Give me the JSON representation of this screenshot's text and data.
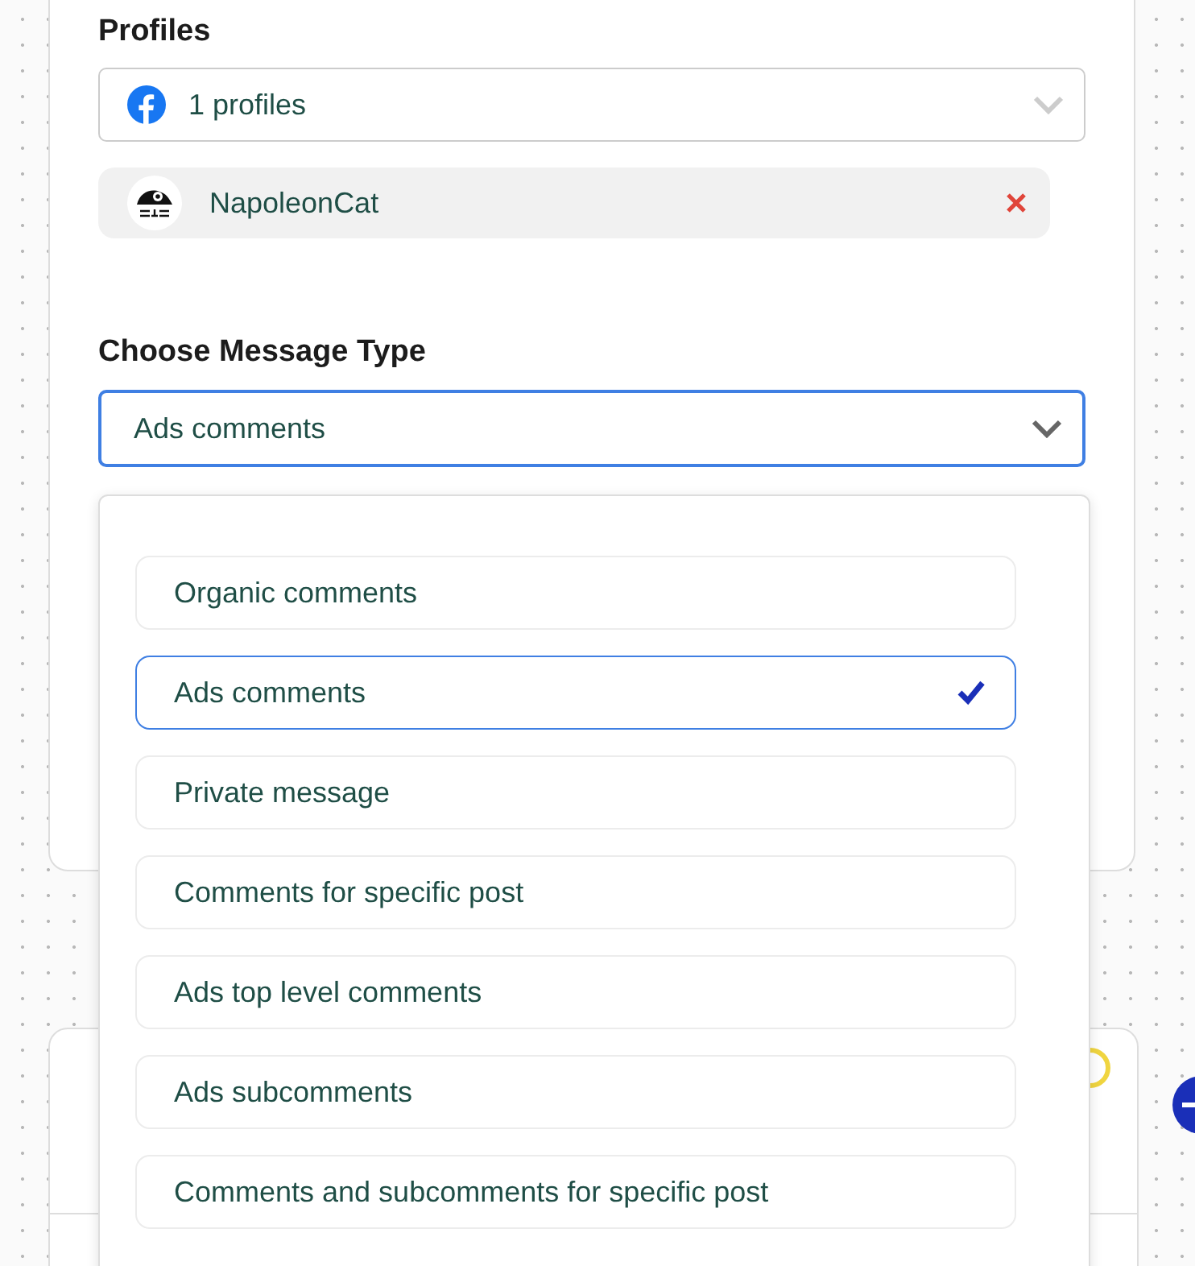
{
  "profiles": {
    "label": "Profiles",
    "select": {
      "value": "1 profiles"
    },
    "chips": [
      {
        "name": "NapoleonCat"
      }
    ]
  },
  "message_type": {
    "label": "Choose Message Type",
    "select": {
      "value": "Ads comments",
      "focused": true
    },
    "options": [
      {
        "label": "Organic comments",
        "selected": false
      },
      {
        "label": "Ads comments",
        "selected": true
      },
      {
        "label": "Private message",
        "selected": false
      },
      {
        "label": "Comments for specific post",
        "selected": false
      },
      {
        "label": "Ads top level comments",
        "selected": false
      },
      {
        "label": "Ads subcomments",
        "selected": false
      },
      {
        "label": "Comments and subcomments for specific post",
        "selected": false
      }
    ]
  }
}
